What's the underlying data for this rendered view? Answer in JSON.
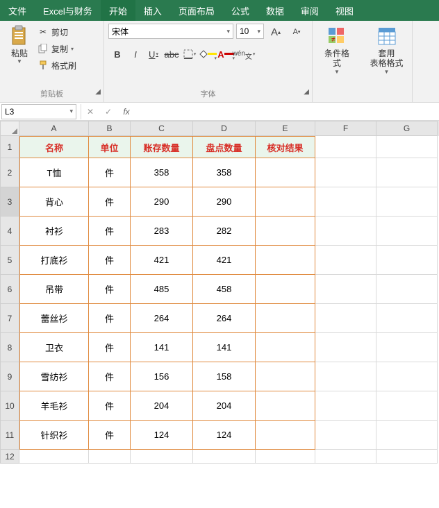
{
  "tabs": [
    "文件",
    "Excel与财务",
    "开始",
    "插入",
    "页面布局",
    "公式",
    "数据",
    "审阅",
    "视图"
  ],
  "active_tab": 2,
  "clipboard": {
    "paste": "粘贴",
    "cut": "剪切",
    "copy": "复制",
    "fmtpaint": "格式刷",
    "group": "剪贴板"
  },
  "font": {
    "name": "宋体",
    "size": "10",
    "group": "字体",
    "bold": "B",
    "italic": "I",
    "under": "U",
    "strike": "abc",
    "wen": "wén"
  },
  "styles": {
    "cond": "条件格式",
    "table": "套用\n表格格式"
  },
  "namebox": "L3",
  "fx": "fx",
  "columns": [
    "A",
    "B",
    "C",
    "D",
    "E",
    "F",
    "G"
  ],
  "headers": [
    "名称",
    "单位",
    "账存数量",
    "盘点数量",
    "核对结果"
  ],
  "rows": [
    {
      "n": "1"
    },
    {
      "n": "2",
      "a": "T恤",
      "b": "件",
      "c": "358",
      "d": "358"
    },
    {
      "n": "3",
      "a": "背心",
      "b": "件",
      "c": "290",
      "d": "290"
    },
    {
      "n": "4",
      "a": "衬衫",
      "b": "件",
      "c": "283",
      "d": "282"
    },
    {
      "n": "5",
      "a": "打底衫",
      "b": "件",
      "c": "421",
      "d": "421"
    },
    {
      "n": "6",
      "a": "吊带",
      "b": "件",
      "c": "485",
      "d": "458"
    },
    {
      "n": "7",
      "a": "蕾丝衫",
      "b": "件",
      "c": "264",
      "d": "264"
    },
    {
      "n": "8",
      "a": "卫衣",
      "b": "件",
      "c": "141",
      "d": "141"
    },
    {
      "n": "9",
      "a": "雪纺衫",
      "b": "件",
      "c": "156",
      "d": "158"
    },
    {
      "n": "10",
      "a": "羊毛衫",
      "b": "件",
      "c": "204",
      "d": "204"
    },
    {
      "n": "11",
      "a": "针织衫",
      "b": "件",
      "c": "124",
      "d": "124"
    },
    {
      "n": "12"
    }
  ]
}
